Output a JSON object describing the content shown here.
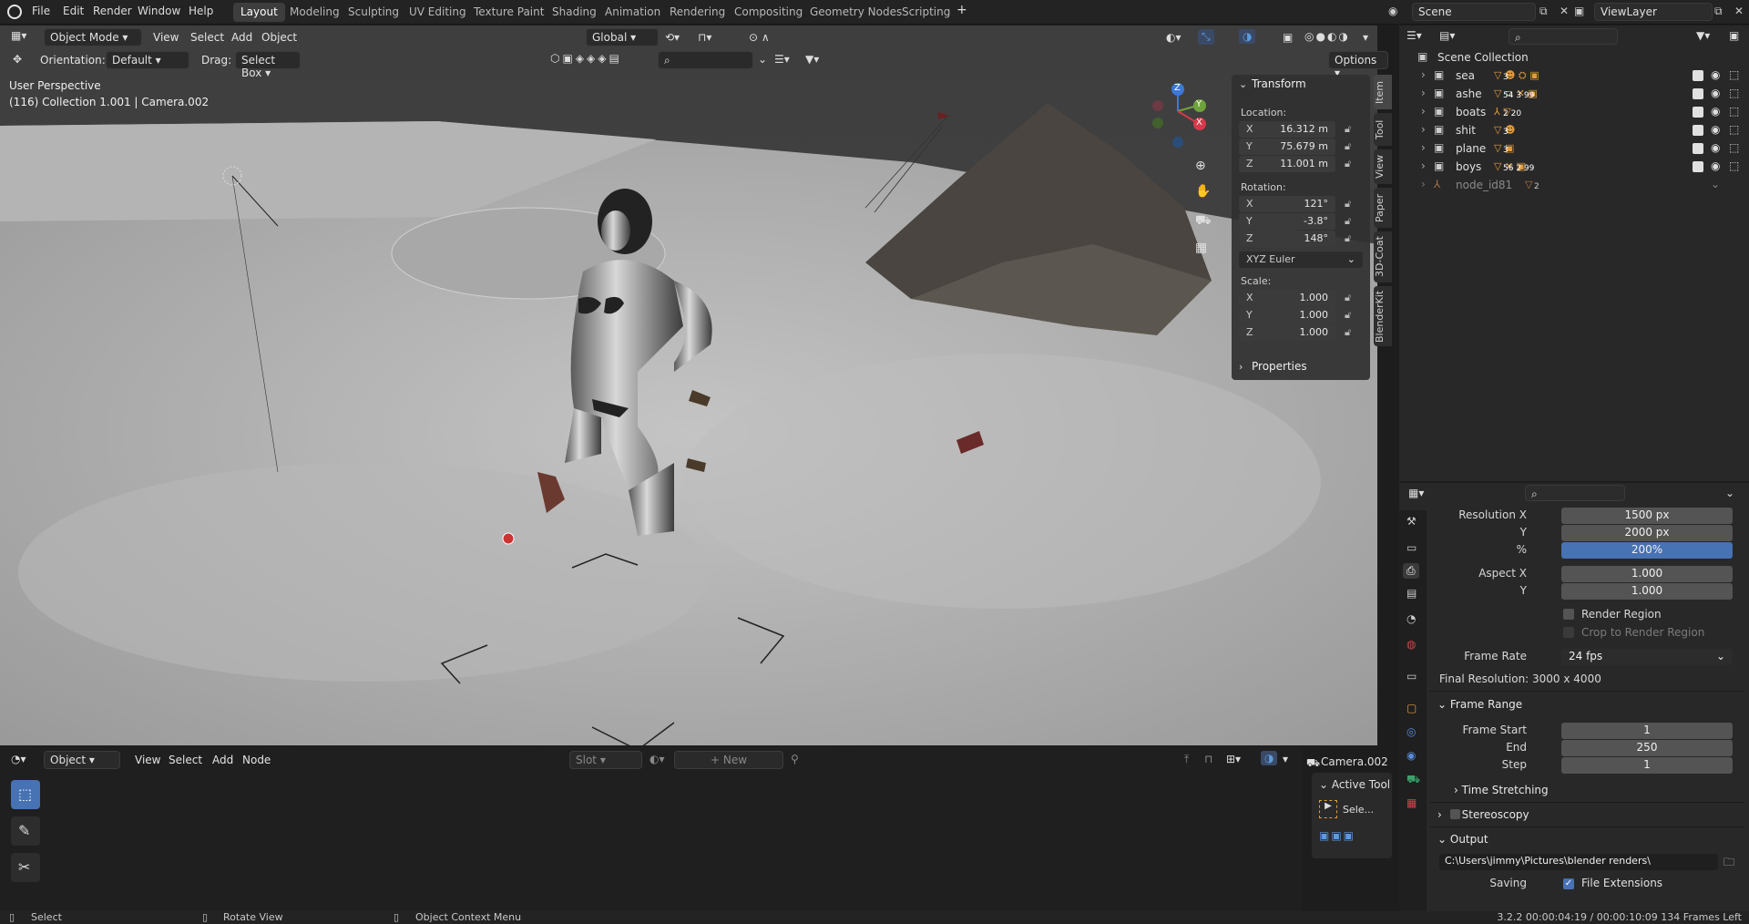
{
  "menu": {
    "file": "File",
    "edit": "Edit",
    "render": "Render",
    "window": "Window",
    "help": "Help"
  },
  "workspaces": [
    "Layout",
    "Modeling",
    "Sculpting",
    "UV Editing",
    "Texture Paint",
    "Shading",
    "Animation",
    "Rendering",
    "Compositing",
    "Geometry Nodes",
    "Scripting"
  ],
  "active_workspace": "Layout",
  "scene": {
    "label": "Scene",
    "view_layer": "ViewLayer"
  },
  "viewport": {
    "mode": "Object Mode",
    "menu": [
      "View",
      "Select",
      "Add",
      "Object"
    ],
    "orientation_transform": "Global",
    "orientation_label": "Orientation:",
    "orientation_value": "Default",
    "drag_label": "Drag:",
    "drag_value": "Select Box",
    "options": "Options",
    "overlay_title": "User Perspective",
    "overlay_sub": "(116) Collection 1.001 | Camera.002"
  },
  "transform_panel": {
    "title": "Transform",
    "location_label": "Location:",
    "location": [
      {
        "axis": "X",
        "value": "16.312 m"
      },
      {
        "axis": "Y",
        "value": "75.679 m"
      },
      {
        "axis": "Z",
        "value": "11.001 m"
      }
    ],
    "rotation_label": "Rotation:",
    "rotation": [
      {
        "axis": "X",
        "value": "121°"
      },
      {
        "axis": "Y",
        "value": "-3.8°"
      },
      {
        "axis": "Z",
        "value": "148°"
      }
    ],
    "rotation_mode": "XYZ Euler",
    "scale_label": "Scale:",
    "scale": [
      {
        "axis": "X",
        "value": "1.000"
      },
      {
        "axis": "Y",
        "value": "1.000"
      },
      {
        "axis": "Z",
        "value": "1.000"
      }
    ],
    "properties": "Properties"
  },
  "side_tabs": [
    "Item",
    "Tool",
    "View",
    "Paper",
    "3D-Coat",
    "BlenderKit"
  ],
  "gizmo": {
    "x": "X",
    "y": "Y",
    "z": "Z"
  },
  "outliner": {
    "root": "Scene Collection",
    "rows": [
      {
        "name": "sea",
        "badges": "3"
      },
      {
        "name": "ashe",
        "badges": "54  3  99"
      },
      {
        "name": "boats",
        "badges": "2  20"
      },
      {
        "name": "shit",
        "badges": "3"
      },
      {
        "name": "plane",
        "badges": "3"
      },
      {
        "name": "boys",
        "badges": "56  2  99"
      },
      {
        "name": "node_id81",
        "badges": "2"
      }
    ]
  },
  "properties": {
    "res_x_label": "Resolution X",
    "res_x": "1500 px",
    "res_y_label": "Y",
    "res_y": "2000 px",
    "res_pct_label": "%",
    "res_pct": "200%",
    "aspect_x_label": "Aspect X",
    "aspect_x": "1.000",
    "aspect_y_label": "Y",
    "aspect_y": "1.000",
    "render_region": "Render Region",
    "crop_region": "Crop to Render Region",
    "frame_rate_label": "Frame Rate",
    "frame_rate": "24 fps",
    "final_res": "Final Resolution: 3000 x 4000",
    "frame_range": "Frame Range",
    "frame_start_label": "Frame Start",
    "frame_start": "1",
    "end_label": "End",
    "end": "250",
    "step_label": "Step",
    "step": "1",
    "time_stretching": "Time Stretching",
    "stereoscopy": "Stereoscopy",
    "output": "Output",
    "output_path": "C:\\Users\\jimmy\\Pictures\\blender renders\\",
    "saving_label": "Saving",
    "file_extensions": "File Extensions"
  },
  "node_editor": {
    "type": "Object",
    "menu": [
      "View",
      "Select",
      "Add",
      "Node"
    ],
    "slot": "Slot",
    "new": "New",
    "camera": "Camera.002",
    "active_tool": "Active Tool",
    "active_tool_sel": "Sele..."
  },
  "status": {
    "select": "Select",
    "rotate": "Rotate View",
    "context": "Object Context Menu",
    "version": "3.2.2  00:00:04:19 / 00:00:10:09  134 Frames Left"
  }
}
